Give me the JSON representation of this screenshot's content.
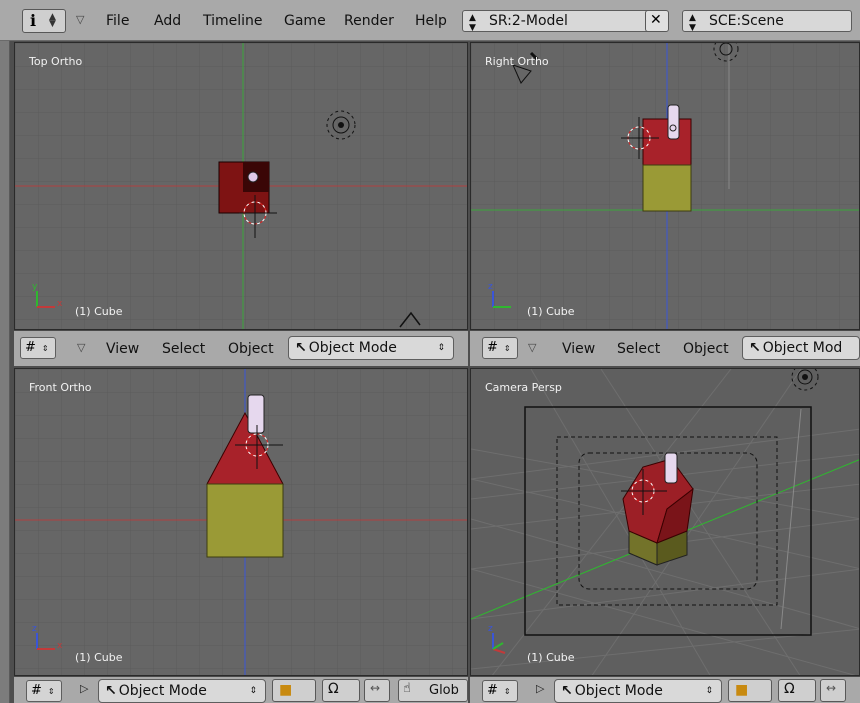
{
  "menubar": {
    "info_icon": "info-icon",
    "items": [
      "File",
      "Add",
      "Timeline",
      "Game",
      "Render",
      "Help"
    ],
    "screen_field": "SR:2-Model",
    "scene_field": "SCE:Scene",
    "close_label": "✕"
  },
  "viewports": {
    "top": {
      "name": "Top Ortho",
      "object": "(1) Cube"
    },
    "right": {
      "name": "Right Ortho",
      "object": "(1) Cube"
    },
    "front": {
      "name": "Front Ortho",
      "object": "(1) Cube"
    },
    "camera": {
      "name": "Camera Persp",
      "object": "(1) Cube"
    }
  },
  "headers": {
    "view": "View",
    "select": "Select",
    "object": "Object",
    "mode_left": "Object Mode",
    "mode_right": "Object Mod",
    "mode_bottom": "Object Mode",
    "global_left": "Glob"
  },
  "colors": {
    "viewport_bg": "#666666",
    "header_bg": "#a9a9a9",
    "roof": "#a8222a",
    "walls": "#9a9a36",
    "x_axis": "#c23a3a",
    "y_axis": "#2fb82f",
    "z_axis": "#3a55d8"
  }
}
